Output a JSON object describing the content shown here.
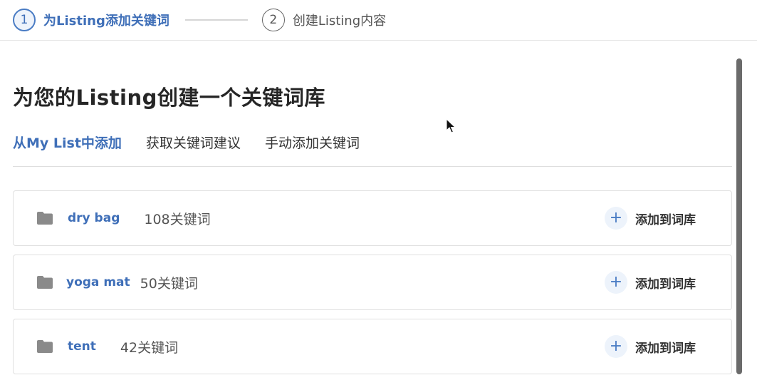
{
  "steps": [
    {
      "number": "1",
      "label": "为Listing添加关键词",
      "state": "active"
    },
    {
      "number": "2",
      "label": "创建Listing内容",
      "state": "inactive"
    }
  ],
  "main": {
    "title": "为您的Listing创建一个关键词库",
    "tabs": [
      {
        "label": "从My List中添加",
        "active": true
      },
      {
        "label": "获取关键词建议",
        "active": false
      },
      {
        "label": "手动添加关键词",
        "active": false
      }
    ],
    "lists": [
      {
        "name": "dry bag",
        "count": "108关键词",
        "action": "添加到词库",
        "icon": "folder-icon"
      },
      {
        "name": "yoga mat",
        "count": "50关键词",
        "action": "添加到词库",
        "icon": "folder-icon"
      },
      {
        "name": "tent",
        "count": "42关键词",
        "action": "添加到词库",
        "icon": "folder-icon"
      }
    ],
    "plus_glyph": "+"
  },
  "colors": {
    "accent": "#3f6fb8",
    "folder": "#8a8a8a",
    "plus_bg": "#edf3fb"
  }
}
